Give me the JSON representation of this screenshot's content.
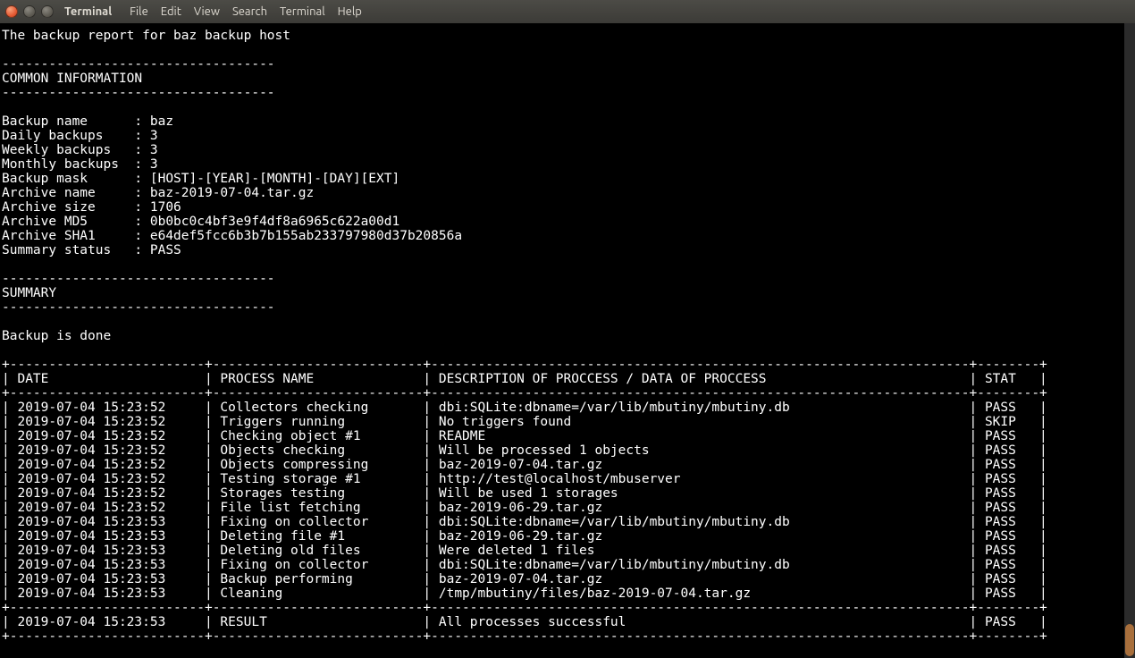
{
  "titlebar": {
    "app": "Terminal",
    "menus": [
      "File",
      "Edit",
      "View",
      "Search",
      "Terminal",
      "Help"
    ]
  },
  "report": {
    "title": "The backup report for baz backup host",
    "rule": "-----------------------------------",
    "common_header": "COMMON INFORMATION",
    "fields": [
      {
        "label": "Backup name",
        "value": "baz"
      },
      {
        "label": "Daily backups",
        "value": "3"
      },
      {
        "label": "Weekly backups",
        "value": "3"
      },
      {
        "label": "Monthly backups",
        "value": "3"
      },
      {
        "label": "Backup mask",
        "value": "[HOST]-[YEAR]-[MONTH]-[DAY][EXT]"
      },
      {
        "label": "Archive name",
        "value": "baz-2019-07-04.tar.gz"
      },
      {
        "label": "Archive size",
        "value": "1706"
      },
      {
        "label": "Archive MD5",
        "value": "0b0bc0c4bf3e9f4df8a6965c622a00d1"
      },
      {
        "label": "Archive SHA1",
        "value": "e64def5fcc6b3b7b155ab233797980d37b20856a"
      },
      {
        "label": "Summary status",
        "value": "PASS"
      }
    ],
    "summary_header": "SUMMARY",
    "summary_text": "Backup is done",
    "table": {
      "col_widths": {
        "date": 23,
        "proc": 25,
        "desc": 67,
        "stat": 6
      },
      "header": {
        "date": "DATE",
        "proc": "PROCESS NAME",
        "desc": "DESCRIPTION OF PROCCESS / DATA OF PROCCESS",
        "stat": "STAT"
      },
      "rows": [
        {
          "date": "2019-07-04 15:23:52",
          "proc": "Collectors checking",
          "desc": "dbi:SQLite:dbname=/var/lib/mbutiny/mbutiny.db",
          "stat": "PASS"
        },
        {
          "date": "2019-07-04 15:23:52",
          "proc": "Triggers running",
          "desc": "No triggers found",
          "stat": "SKIP"
        },
        {
          "date": "2019-07-04 15:23:52",
          "proc": "Checking object #1",
          "desc": "README",
          "stat": "PASS"
        },
        {
          "date": "2019-07-04 15:23:52",
          "proc": "Objects checking",
          "desc": "Will be processed 1 objects",
          "stat": "PASS"
        },
        {
          "date": "2019-07-04 15:23:52",
          "proc": "Objects compressing",
          "desc": "baz-2019-07-04.tar.gz",
          "stat": "PASS"
        },
        {
          "date": "2019-07-04 15:23:52",
          "proc": "Testing storage #1",
          "desc": "http://test@localhost/mbuserver",
          "stat": "PASS"
        },
        {
          "date": "2019-07-04 15:23:52",
          "proc": "Storages testing",
          "desc": "Will be used 1 storages",
          "stat": "PASS"
        },
        {
          "date": "2019-07-04 15:23:52",
          "proc": "File list fetching",
          "desc": "baz-2019-06-29.tar.gz",
          "stat": "PASS"
        },
        {
          "date": "2019-07-04 15:23:53",
          "proc": "Fixing on collector",
          "desc": "dbi:SQLite:dbname=/var/lib/mbutiny/mbutiny.db",
          "stat": "PASS"
        },
        {
          "date": "2019-07-04 15:23:53",
          "proc": "Deleting file #1",
          "desc": "baz-2019-06-29.tar.gz",
          "stat": "PASS"
        },
        {
          "date": "2019-07-04 15:23:53",
          "proc": "Deleting old files",
          "desc": "Were deleted 1 files",
          "stat": "PASS"
        },
        {
          "date": "2019-07-04 15:23:53",
          "proc": "Fixing on collector",
          "desc": "dbi:SQLite:dbname=/var/lib/mbutiny/mbutiny.db",
          "stat": "PASS"
        },
        {
          "date": "2019-07-04 15:23:53",
          "proc": "Backup performing",
          "desc": "baz-2019-07-04.tar.gz",
          "stat": "PASS"
        },
        {
          "date": "2019-07-04 15:23:53",
          "proc": "Cleaning",
          "desc": "/tmp/mbutiny/files/baz-2019-07-04.tar.gz",
          "stat": "PASS"
        }
      ],
      "footer": {
        "date": "2019-07-04 15:23:53",
        "proc": "RESULT",
        "desc": "All processes successful",
        "stat": "PASS"
      }
    }
  }
}
